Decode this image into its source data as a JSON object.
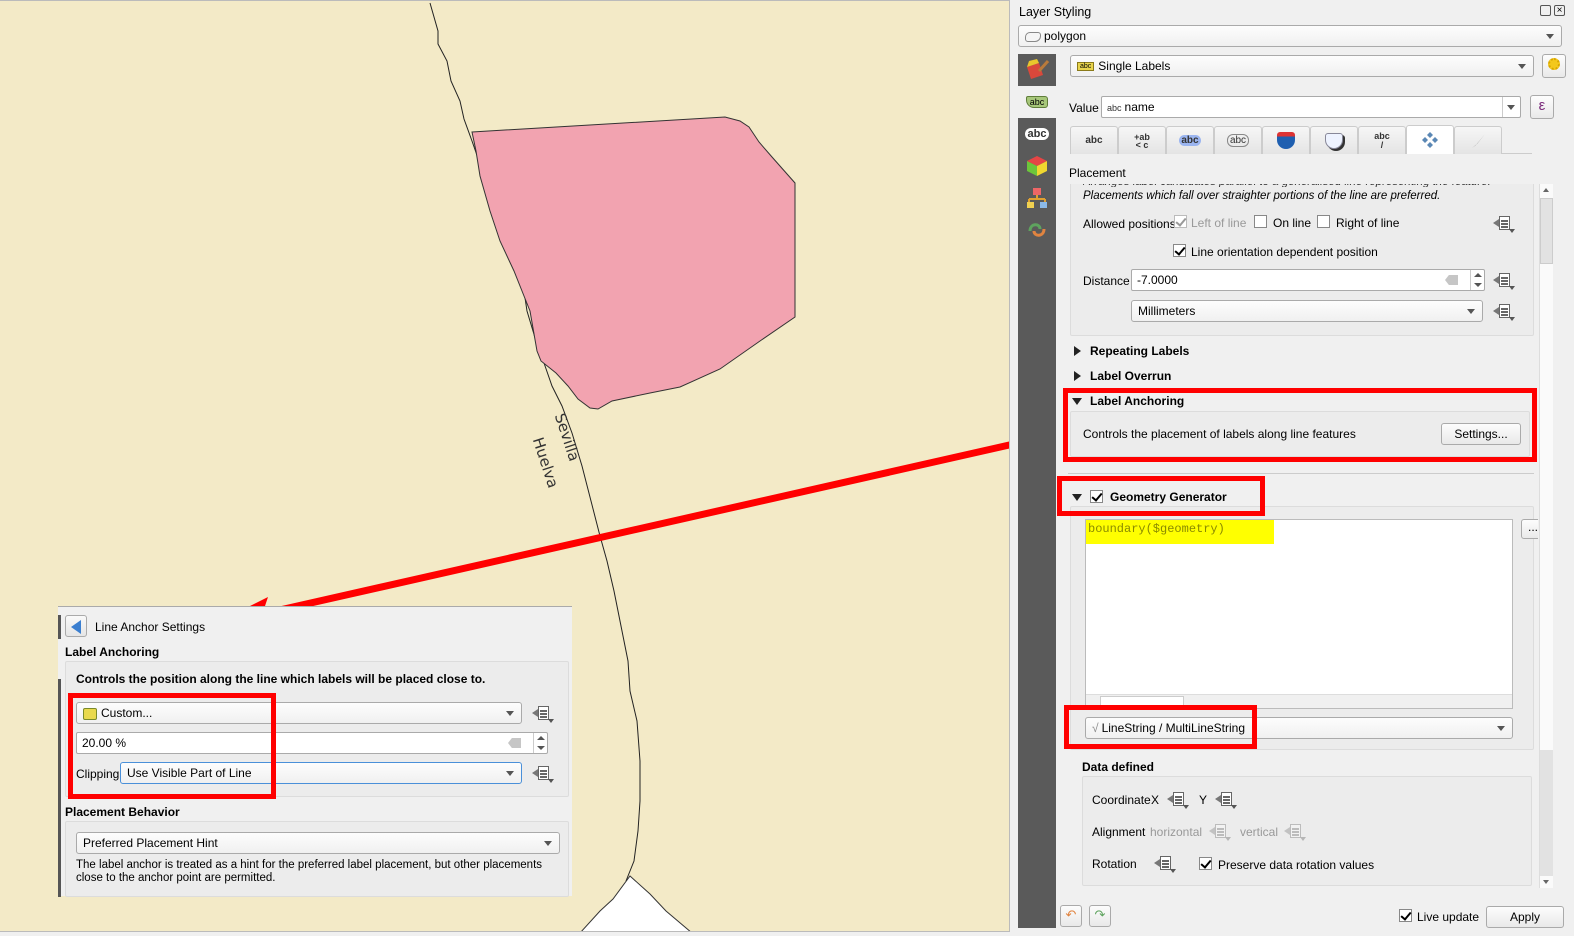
{
  "map": {
    "labels": [
      "Sevilla",
      "Huelva"
    ],
    "colors": {
      "background": "#f3eac7",
      "polygon_fill": "#f2a3b0",
      "annotation": "#ff0000"
    }
  },
  "line_anchor_panel": {
    "title": "Line Anchor Settings",
    "section_label_anchoring": "Label Anchoring",
    "description": "Controls the position along the line which labels will be placed close to.",
    "anchor_mode": "Custom...",
    "percent_value": "20.00 %",
    "clipping_label": "Clipping",
    "clipping_value": "Use Visible Part of Line",
    "section_placement_behavior": "Placement Behavior",
    "placement_behavior_value": "Preferred Placement Hint",
    "placement_behavior_help": "The label anchor is treated as a hint for the preferred label placement, but other placements close to the anchor point are permitted."
  },
  "dock": {
    "title": "Layer Styling",
    "layer": "polygon",
    "renderer": "Single Labels",
    "value_label": "Value",
    "value_prefix": "abc",
    "value_field": "name",
    "expression_icon": "ε",
    "side_tabs": [
      "symbology-icon",
      "labels-icon",
      "diagrams-icon",
      "3d-view-icon",
      "mask-icon",
      "history-icon"
    ],
    "label_tabs": [
      {
        "name": "text",
        "glyph": "abc"
      },
      {
        "name": "formatting",
        "glyph": "+ab"
      },
      {
        "name": "buffer",
        "glyph": "abc"
      },
      {
        "name": "mask",
        "glyph": "abc"
      },
      {
        "name": "background",
        "glyph": ""
      },
      {
        "name": "shadow",
        "glyph": ""
      },
      {
        "name": "callouts",
        "glyph": "abc"
      },
      {
        "name": "placement",
        "glyph": ""
      },
      {
        "name": "rendering",
        "glyph": ""
      }
    ],
    "placement": {
      "heading": "Placement",
      "desc_cut": "Arranges label candidates parallel to a generalised line representing the feature.",
      "desc": "Placements which fall over straighter portions of the line are preferred.",
      "allowed_positions_label": "Allowed positions",
      "left_of_line": "Left of line",
      "on_line": "On line",
      "right_of_line": "Right of line",
      "line_orientation": "Line orientation dependent position",
      "distance_label": "Distance",
      "distance_value": "-7.0000",
      "units": "Millimeters"
    },
    "sections": {
      "repeating": "Repeating Labels",
      "overrun": "Label Overrun",
      "anchoring": "Label Anchoring",
      "anchoring_desc": "Controls the placement of labels along line features",
      "settings_button": "Settings...",
      "geometry_generator": "Geometry Generator",
      "expression": "boundary($geometry)",
      "expr_button": "...",
      "geometry_type": "LineString / MultiLineString"
    },
    "data_defined": {
      "heading": "Data defined",
      "coordinate": "Coordinate",
      "x": "X",
      "y": "Y",
      "alignment": "Alignment",
      "horizontal": "horizontal",
      "vertical": "vertical",
      "rotation": "Rotation",
      "preserve_rotation": "Preserve data rotation values"
    },
    "footer": {
      "live_update": "Live update",
      "apply": "Apply"
    }
  }
}
